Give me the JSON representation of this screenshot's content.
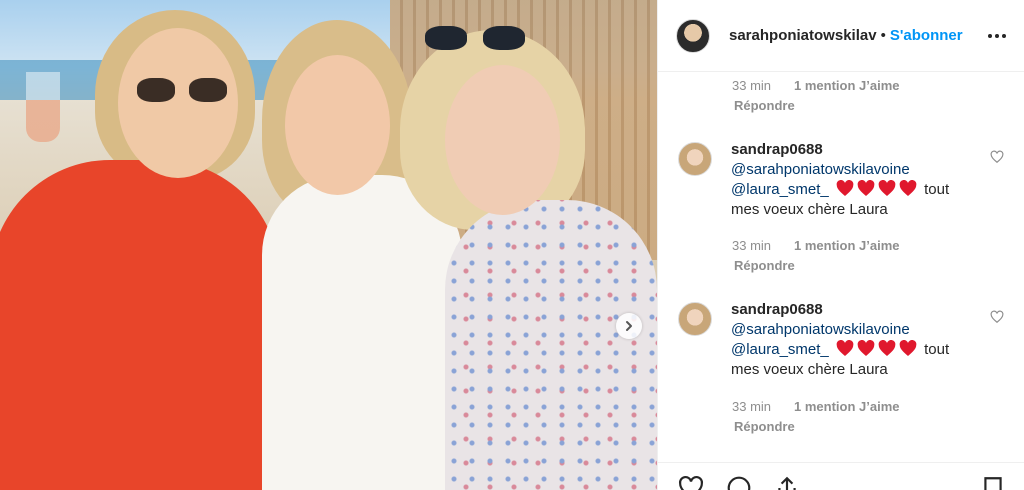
{
  "post": {
    "username": "sarahponiatowskilav",
    "separator": "•",
    "follow_label": "S'abonner"
  },
  "top_meta": {
    "time": "33 min",
    "likes": "1 mention J’aime",
    "reply": "Répondre"
  },
  "comments": [
    {
      "user": "sandrap0688",
      "mention1": "@sarahponiatowskilavoine",
      "mention2": "@laura_smet_",
      "after_hearts": "tout",
      "line3": "mes voeux chère Laura",
      "hearts": 4,
      "time": "33 min",
      "likes": "1 mention J’aime",
      "reply": "Répondre"
    },
    {
      "user": "sandrap0688",
      "mention1": "@sarahponiatowskilavoine",
      "mention2": "@laura_smet_",
      "after_hearts": "tout",
      "line3": "mes voeux chère Laura",
      "hearts": 4,
      "time": "33 min",
      "likes": "1 mention J’aime",
      "reply": "Répondre"
    }
  ],
  "colors": {
    "follow": "#0095f6",
    "heart": "#e0182d",
    "mention": "#00376b",
    "meta": "#8e8e8e"
  },
  "icons": [
    "chevron-right-icon",
    "more-options-icon",
    "heart-icon",
    "like-outline-icon",
    "comment-icon",
    "share-icon",
    "bookmark-icon"
  ]
}
